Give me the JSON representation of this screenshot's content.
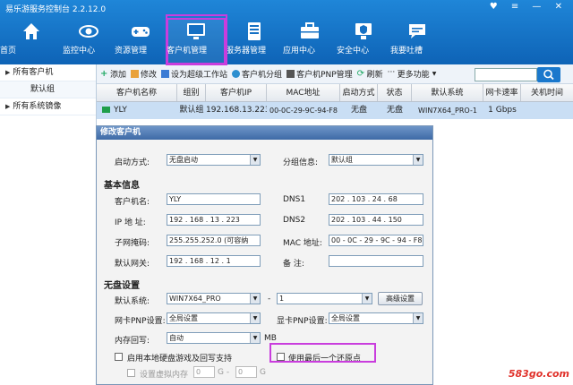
{
  "app": {
    "title": "易乐游服务控制台 2.2.12.0",
    "controls": "♥ ≡ — ✕"
  },
  "nav": [
    {
      "label": "首页",
      "icon": "home-icon"
    },
    {
      "label": "监控中心",
      "icon": "eye-icon"
    },
    {
      "label": "资源管理",
      "icon": "gamepad-icon"
    },
    {
      "label": "客户机管理",
      "icon": "monitor-icon"
    },
    {
      "label": "服务器管理",
      "icon": "server-icon"
    },
    {
      "label": "应用中心",
      "icon": "briefcase-icon"
    },
    {
      "label": "安全中心",
      "icon": "shield-icon"
    },
    {
      "label": "我要吐槽",
      "icon": "chat-icon"
    }
  ],
  "sidebar": {
    "all_clients": "所有客户机",
    "default_group": "默认组",
    "all_images": "所有系统镜像"
  },
  "toolbar": {
    "add": "添加",
    "edit": "修改",
    "set_super": "设为超级工作站",
    "group": "客户机分组",
    "pnp": "客户机PNP管理",
    "refresh": "刷新",
    "more": "更多功能"
  },
  "table": {
    "columns": [
      "客户机名称",
      "组别",
      "客户机IP",
      "MAC地址",
      "启动方式",
      "状态",
      "默认系统",
      "网卡速率",
      "关机时间"
    ],
    "rows": [
      [
        "YLY",
        "默认组",
        "192.168.13.223",
        "00-0C-29-9C-94-F8",
        "无盘",
        "无盘",
        "WIN7X64_PRO-1",
        "1 Gbps",
        ""
      ]
    ]
  },
  "dialog": {
    "title": "修改客户机",
    "boot_label": "启动方式:",
    "boot_value": "无盘启动",
    "group_label": "分组信息:",
    "group_value": "默认组",
    "basic_title": "基本信息",
    "name_label": "客户机名:",
    "name_value": "YLY",
    "dns1_label": "DNS1",
    "dns1_value": "202 . 103 . 24 . 68",
    "ip_label": "IP 地 址:",
    "ip_value": "192 . 168 . 13 . 223",
    "dns2_label": "DNS2",
    "dns2_value": "202 . 103 . 44 . 150",
    "mask_label": "子网掩码:",
    "mask_value": "255.255.252.0  (可容纳",
    "mac_label": "MAC 地址:",
    "mac_value": "00 - 0C - 29 - 9C - 94 - F8",
    "gw_label": "默认网关:",
    "gw_value": "192 . 168 . 12 . 1",
    "note_label": "备    注:",
    "note_value": "",
    "diskless_title": "无盘设置",
    "os_label": "默认系统:",
    "os_value": "WIN7X64_PRO",
    "dash": "-",
    "os_sub": "1",
    "adv_btn": "高级设置",
    "nic_label": "网卡PNP设置:",
    "nic_value": "全局设置",
    "gpu_label": "显卡PNP设置:",
    "gpu_value": "全局设置",
    "mem_label": "内存回写:",
    "mem_value": "自动",
    "mem_unit": "MB",
    "local_disk": "启用本地硬盘游戏及回写支持",
    "last_restore": "使用最后一个还原点",
    "virt_mem": "设置虚拟内存",
    "vm_min": "0",
    "vm_g": "G -",
    "vm_max": "0",
    "vm_g2": "G"
  },
  "watermark": "583go.com"
}
